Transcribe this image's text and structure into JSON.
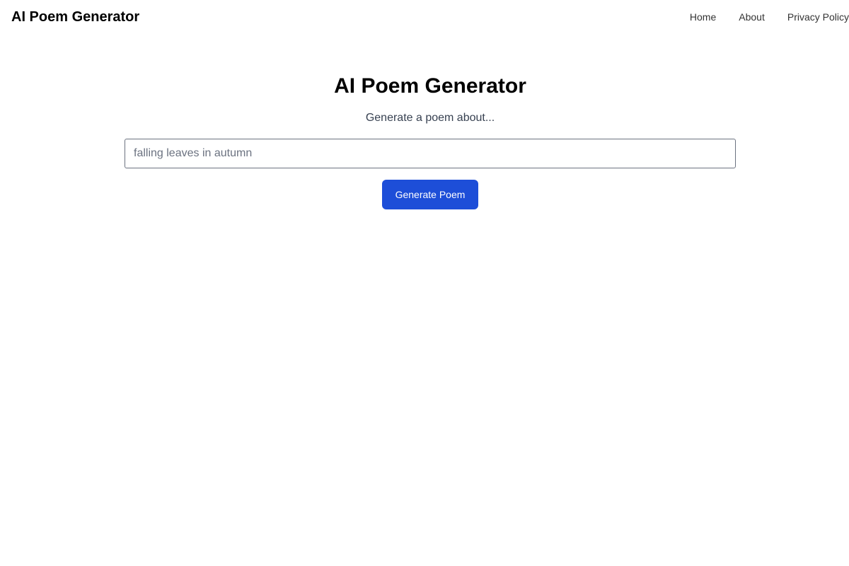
{
  "header": {
    "brand": "AI Poem Generator",
    "nav": {
      "home": "Home",
      "about": "About",
      "privacy": "Privacy Policy"
    }
  },
  "main": {
    "title": "AI Poem Generator",
    "subtitle": "Generate a poem about...",
    "topic_input": {
      "value": "",
      "placeholder": "falling leaves in autumn"
    },
    "generate_label": "Generate Poem"
  },
  "colors": {
    "accent": "#1d4ed8",
    "background": "#ffffff"
  }
}
